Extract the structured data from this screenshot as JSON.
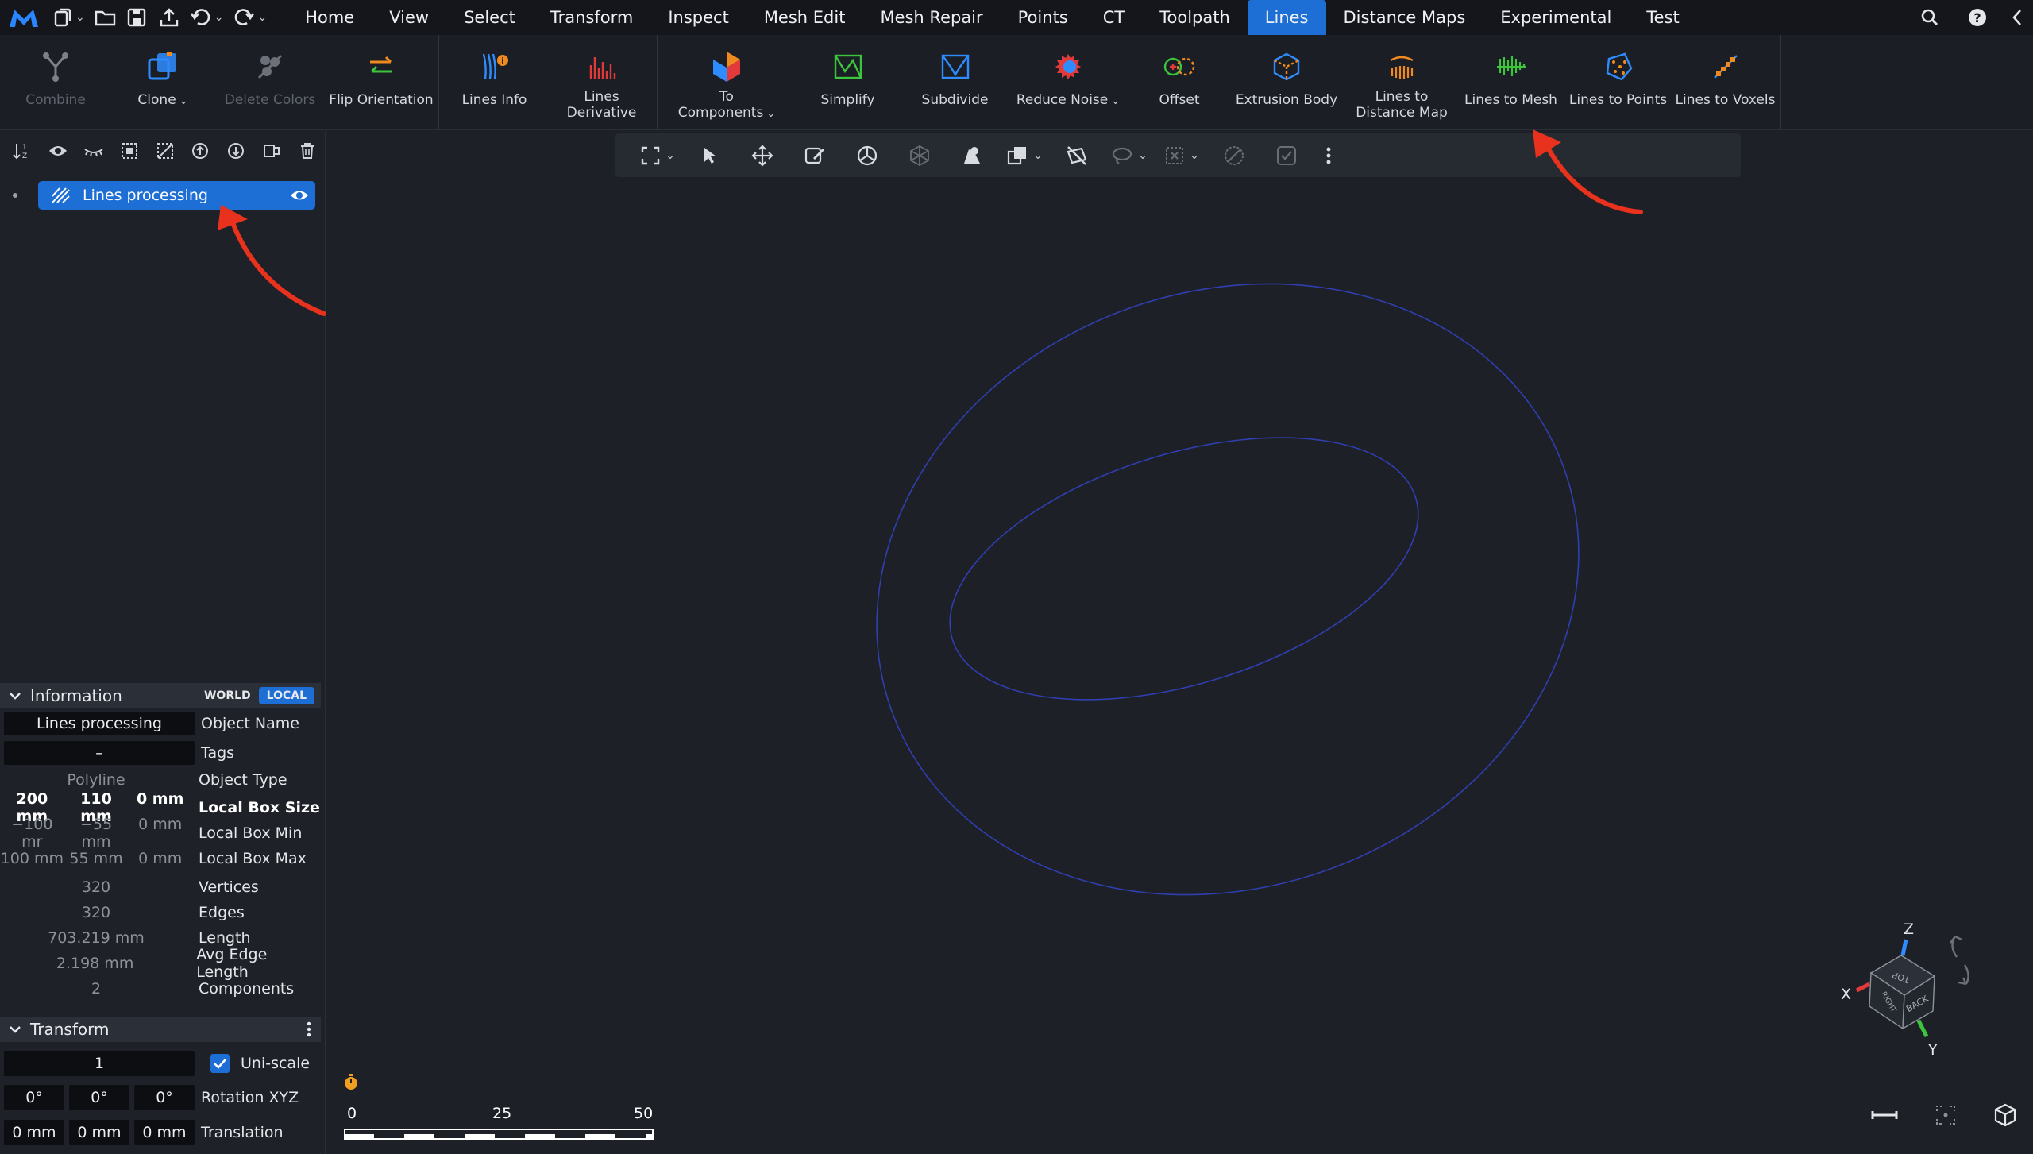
{
  "menubar": {
    "tabs": [
      {
        "label": "Home"
      },
      {
        "label": "View"
      },
      {
        "label": "Select"
      },
      {
        "label": "Transform"
      },
      {
        "label": "Inspect"
      },
      {
        "label": "Mesh Edit"
      },
      {
        "label": "Mesh Repair"
      },
      {
        "label": "Points"
      },
      {
        "label": "CT"
      },
      {
        "label": "Toolpath"
      },
      {
        "label": "Lines"
      },
      {
        "label": "Distance Maps"
      },
      {
        "label": "Experimental"
      },
      {
        "label": "Test"
      }
    ],
    "active_tab": "Lines"
  },
  "ribbon": {
    "combine": "Combine",
    "clone": "Clone",
    "delete_colors": "Delete Colors",
    "flip_orientation": "Flip Orientation",
    "lines_info": "Lines Info",
    "lines_derivative": "Lines\nDerivative",
    "to_components": "To\nComponents",
    "simplify": "Simplify",
    "subdivide": "Subdivide",
    "reduce_noise": "Reduce Noise",
    "offset": "Offset",
    "extrusion_body": "Extrusion Body",
    "lines_to_distance_map": "Lines to\nDistance Map",
    "lines_to_mesh": "Lines to Mesh",
    "lines_to_points": "Lines to Points",
    "lines_to_voxels": "Lines to Voxels"
  },
  "scene": {
    "object_name": "Lines processing"
  },
  "information": {
    "title": "Information",
    "world": "WORLD",
    "local": "LOCAL",
    "object_name_value": "Lines processing",
    "object_name_label": "Object Name",
    "tags_value": "–",
    "tags_label": "Tags",
    "object_type_value": "Polyline",
    "object_type_label": "Object Type",
    "box_size": [
      "200 mm",
      "110 mm",
      "0 mm"
    ],
    "box_size_label": "Local Box Size",
    "box_min": [
      "−100 mr",
      "−55 mm",
      "0 mm"
    ],
    "box_min_label": "Local Box Min",
    "box_max": [
      "100 mm",
      "55 mm",
      "0 mm"
    ],
    "box_max_label": "Local Box Max",
    "vertices_value": "320",
    "vertices_label": "Vertices",
    "edges_value": "320",
    "edges_label": "Edges",
    "length_value": "703.219 mm",
    "length_label": "Length",
    "avg_edge_value": "2.198 mm",
    "avg_edge_label": "Avg Edge Length",
    "components_value": "2",
    "components_label": "Components"
  },
  "transform": {
    "title": "Transform",
    "scale_value": "1",
    "uniscale_label": "Uni-scale",
    "uniscale_checked": true,
    "rotation": [
      "0°",
      "0°",
      "0°"
    ],
    "rotation_label": "Rotation XYZ",
    "translation": [
      "0 mm",
      "0 mm",
      "0 mm"
    ],
    "translation_label": "Translation"
  },
  "viewport": {
    "scale_labels": [
      "0",
      "25",
      "50"
    ],
    "axis_labels": {
      "x": "X",
      "y": "Y",
      "z": "Z"
    },
    "cube_faces": {
      "top": "TOP",
      "back": "BACK",
      "right": "RIGHT"
    }
  },
  "colors": {
    "accent": "#1d6fd6",
    "annotation_arrow": "#e8321e",
    "curve": "#2f3fb0"
  }
}
